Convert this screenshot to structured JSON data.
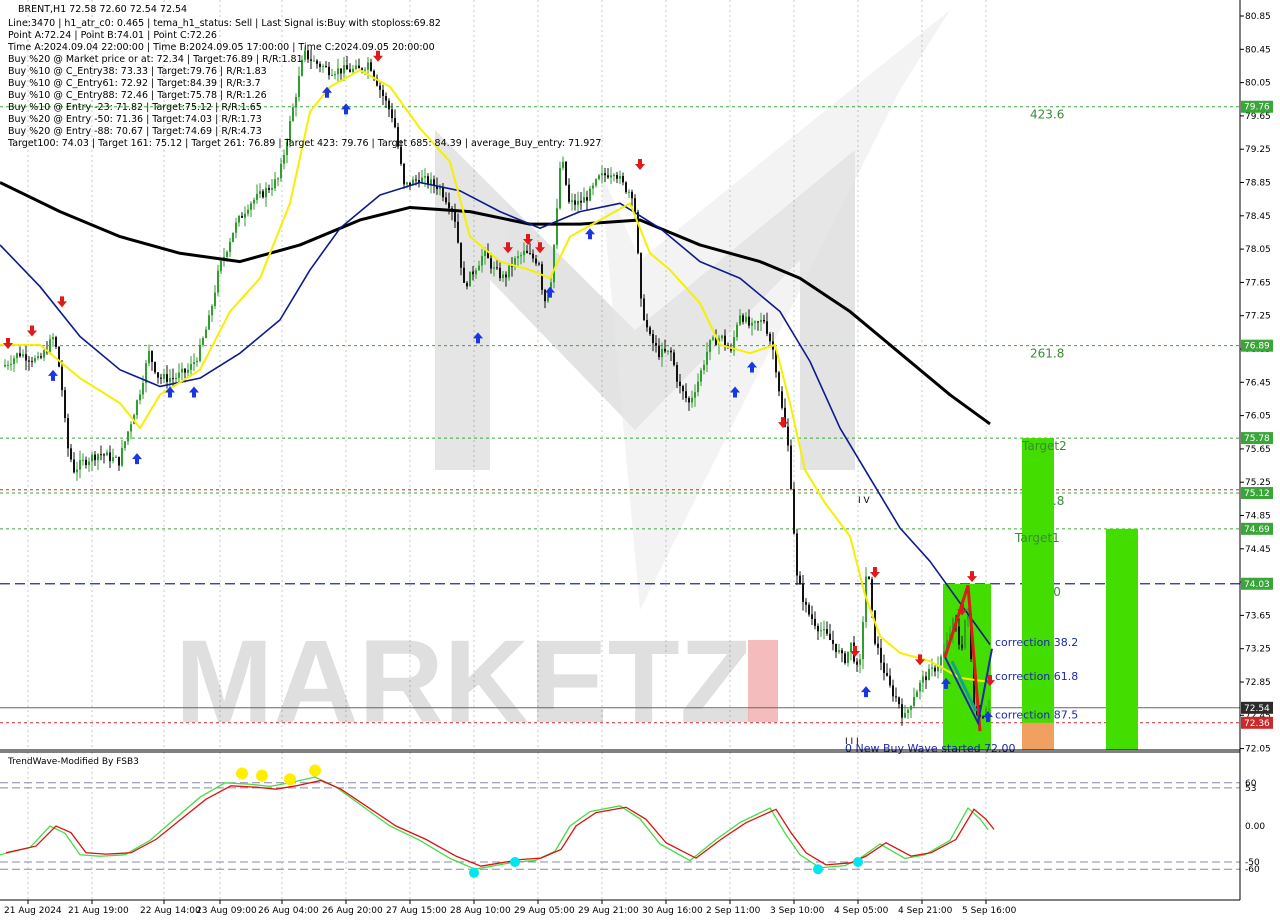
{
  "header": {
    "symbol_line": "BRENT,H1  72.58 72.60 72.54 72.54",
    "info_lines": [
      "Line:3470  |  h1_atr_c0: 0.465  |  tema_h1_status: Sell  |  Last Signal is:Buy with stoploss:69.82",
      "Point A:72.24  |  Point B:74.01  |  Point C:72.26",
      "Time A:2024.09.04 22:00:00  |  Time B:2024.09.05 17:00:00  |  Time C:2024.09.05 20:00:00",
      "Buy %20 @ Market price or at: 72.34  |  Target:76.89  |  R/R:1.81",
      "Buy %10 @ C_Entry38: 73.33  |  Target:79.76  |  R/R:1.83",
      "Buy %10 @ C_Entry61: 72.92  |  Target:84.39  |  R/R:3.7",
      "Buy %10 @ C_Entry88: 72.46  |  Target:75.78  |  R/R:1.26",
      "Buy %10 @ Entry -23: 71.82  |  Target:75.12  |  R/R:1.65",
      "Buy %20 @ Entry -50: 71.36  |  Target:74.03  |  R/R:1.73",
      "Buy %20 @ Entry -88: 70.67  |  Target:74.69  |  R/R:4.73",
      "Target100: 74.03  |  Target 161: 75.12  |  Target 261: 76.89  |  Target 423: 79.76  |  Target 685: 84.39  |  average_Buy_entry: 71.927"
    ]
  },
  "price_axis": {
    "ticks": [
      "80.85",
      "80.45",
      "80.05",
      "79.65",
      "79.25",
      "78.85",
      "78.45",
      "78.05",
      "77.65",
      "77.25",
      "76.85",
      "76.45",
      "76.05",
      "75.65",
      "75.25",
      "74.85",
      "74.45",
      "74.05",
      "73.65",
      "73.25",
      "72.85",
      "72.45",
      "72.05"
    ],
    "badges": [
      {
        "label": "79.76",
        "price": 79.76,
        "color": "#3aa63a"
      },
      {
        "label": "76.89",
        "price": 76.89,
        "color": "#3aa63a"
      },
      {
        "label": "75.78",
        "price": 75.78,
        "color": "#3aa63a"
      },
      {
        "label": "75.12",
        "price": 75.12,
        "color": "#3aa63a"
      },
      {
        "label": "74.69",
        "price": 74.69,
        "color": "#3aa63a"
      },
      {
        "label": "74.03",
        "price": 74.03,
        "color": "#3aa63a"
      },
      {
        "label": "72.54",
        "price": 72.54,
        "color": "#2b2b2b"
      },
      {
        "label": "72.36",
        "price": 72.36,
        "color": "#cc2a2a"
      }
    ]
  },
  "levels": [
    {
      "label": "423.6",
      "price": 79.76,
      "color": "#3aa63a",
      "style": "dot"
    },
    {
      "label": "261.8",
      "price": 76.89,
      "color": "#3aa63a",
      "style": "dot"
    },
    {
      "label": "",
      "price": 75.78,
      "color": "#3aa63a",
      "style": "dot"
    },
    {
      "label": "161.8",
      "price": 75.12,
      "color": "#3aa63a",
      "style": "dot"
    },
    {
      "label": "",
      "price": 75.16,
      "color": "#cc2a2a",
      "style": "dot"
    },
    {
      "label": "",
      "price": 74.69,
      "color": "#3aa63a",
      "style": "dot"
    },
    {
      "label": "100",
      "price": 74.03,
      "color": "#1e2aa8",
      "style": "dash"
    },
    {
      "label": "",
      "price": 72.54,
      "color": "#666666",
      "style": "solid"
    },
    {
      "label": "",
      "price": 72.36,
      "color": "#cc2a2a",
      "style": "dot"
    }
  ],
  "box_labels": {
    "target2": "Target2",
    "target1": "Target1"
  },
  "wave_labels": {
    "iv": "I V",
    "iii": "I I I",
    "new_wave": "0 New Buy Wave started  72.00"
  },
  "corrections": [
    {
      "label": "correction 38.2",
      "price": 73.33
    },
    {
      "label": "correction 61.8",
      "price": 72.92
    },
    {
      "label": "correction 87.5",
      "price": 72.46
    }
  ],
  "watermark": "MARKETZ",
  "time_axis": [
    "21 Aug 2024",
    "21 Aug 19:00",
    "22 Aug 14:00",
    "23 Aug 09:00",
    "26 Aug 04:00",
    "26 Aug 20:00",
    "27 Aug 15:00",
    "28 Aug 10:00",
    "29 Aug 05:00",
    "29 Aug 21:00",
    "30 Aug 16:00",
    "2 Sep 11:00",
    "3 Sep 10:00",
    "4 Sep 05:00",
    "4 Sep 21:00",
    "5 Sep 16:00"
  ],
  "indicator": {
    "title": "TrendWave-Modified By FSB3",
    "ticks": [
      "60",
      "53",
      "0.00",
      "-50",
      "-60"
    ],
    "colors": {
      "fast": "#44dd44",
      "slow": "#dd1111",
      "top_dot": "#ffee00",
      "bottom_dot": "#00e5ee"
    }
  },
  "colors": {
    "ma_black": "#000000",
    "ma_blue": "#0c1a8c",
    "ma_yellow": "#f5f000",
    "bull": "#2f9e2f",
    "bear": "#111111",
    "box_green": "#44dd00",
    "box_orange": "#f0a060"
  }
}
